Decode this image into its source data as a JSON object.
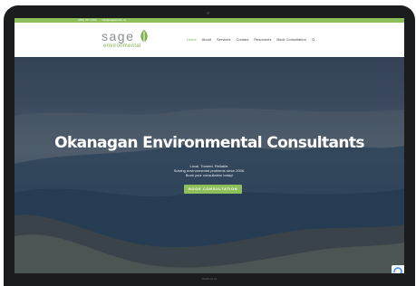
{
  "device": {
    "label": "MacBook Air"
  },
  "topbar": {
    "phone": "(250) 767-7160",
    "email": "info@sageenviro.ca",
    "color": "#8dbf5a"
  },
  "logo": {
    "main": "sage",
    "sub": "environmental",
    "leaf_color": "#7fb24f"
  },
  "nav": {
    "items": [
      "Home",
      "About",
      "Services",
      "Contact",
      "Resources",
      "Book Consultation"
    ],
    "active_item": "Home",
    "active_color": "#7fb24f",
    "search_icon": "search-icon"
  },
  "hero": {
    "title": "Okanagan Environmental Consultants",
    "lines": [
      "Local. Trusted. Reliable.",
      "Solving environmental problems since 2006.",
      "Book your consultation today!"
    ],
    "cta_label": "BOOK CONSULTATION",
    "cta_color": "#8dbf5a"
  },
  "recaptcha": {
    "icon": "recaptcha-icon"
  }
}
